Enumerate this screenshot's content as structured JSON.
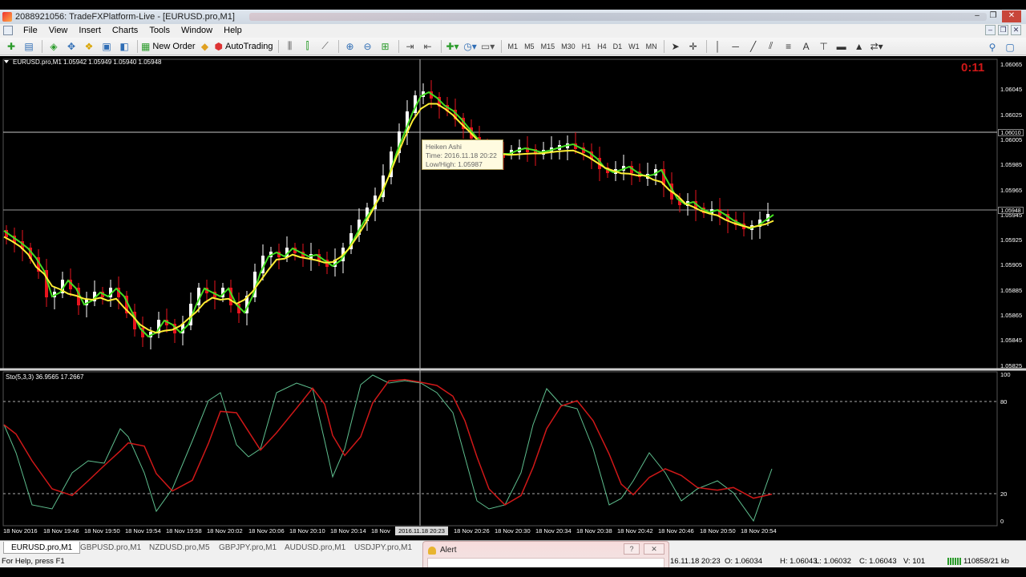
{
  "window": {
    "title": "2088921056: TradeFXPlatform-Live - [EURUSD.pro,M1]",
    "controls": [
      "‒",
      "❐",
      "✕"
    ]
  },
  "menu": [
    "File",
    "View",
    "Insert",
    "Charts",
    "Tools",
    "Window",
    "Help"
  ],
  "toolbar": {
    "new_order": "New Order",
    "auto_trading": "AutoTrading",
    "timeframes": [
      "M1",
      "M5",
      "M15",
      "M30",
      "H1",
      "H4",
      "D1",
      "W1",
      "MN"
    ]
  },
  "chart": {
    "header": "EURUSD.pro,M1 1.05942 1.05949 1.05940 1.05948",
    "countdown": "0:11",
    "price_ticks": [
      "1.06065",
      "1.06045",
      "1.06025",
      "1.06005",
      "1.05985",
      "1.05965",
      "1.05945",
      "1.05925",
      "1.05905",
      "1.05885",
      "1.05865",
      "1.05845",
      "1.05825"
    ],
    "price_tags": [
      "1.06010",
      "1.05948"
    ],
    "time_ticks": [
      "18 Nov 2016",
      "18 Nov 19:46",
      "18 Nov 19:50",
      "18 Nov 19:54",
      "18 Nov 19:58",
      "18 Nov 20:02",
      "18 Nov 20:06",
      "18 Nov 20:10",
      "18 Nov 20:14",
      "18 Nov",
      "18 Nov 20:26",
      "18 Nov 20:30",
      "18 Nov 20:34",
      "18 Nov 20:38",
      "18 Nov 20:42",
      "18 Nov 20:46",
      "18 Nov 20:50",
      "18 Nov 20:54"
    ],
    "crosshair_time": "2016.11.18 20:23",
    "tooltip": {
      "line1": "Heiken Ashi",
      "line2": "Time: 2016.11.18 20:22",
      "line3": "Low/High: 1.05987"
    },
    "colors": {
      "bull": "#ffffff",
      "bear": "#e8141e",
      "fast_ma": "#44dd22",
      "slow_ma": "#ffee33"
    }
  },
  "stochastic": {
    "label": "Sto(5,3,3) 36.9565 17.2667",
    "levels": [
      "100",
      "80",
      "20",
      "0"
    ],
    "colors": {
      "main": "#5fbf8f",
      "signal": "#d01818"
    }
  },
  "tabs": [
    "EURUSD.pro,M1",
    "GBPUSD.pro,M1",
    "NZDUSD.pro,M5",
    "GBPJPY.pro,M1",
    "AUDUSD.pro,M1",
    "USDJPY.pro,M1"
  ],
  "alert": {
    "title": "Alert",
    "help": "?",
    "close": "✕"
  },
  "status": {
    "help": "For Help, press F1",
    "datetime": "16.11.18 20:23",
    "open": "O: 1.06034",
    "high": "H: 1.06043",
    "low": "L: 1.06032",
    "close": "C: 1.06043",
    "volume": "V: 101",
    "traffic": "110858/21 kb"
  }
}
